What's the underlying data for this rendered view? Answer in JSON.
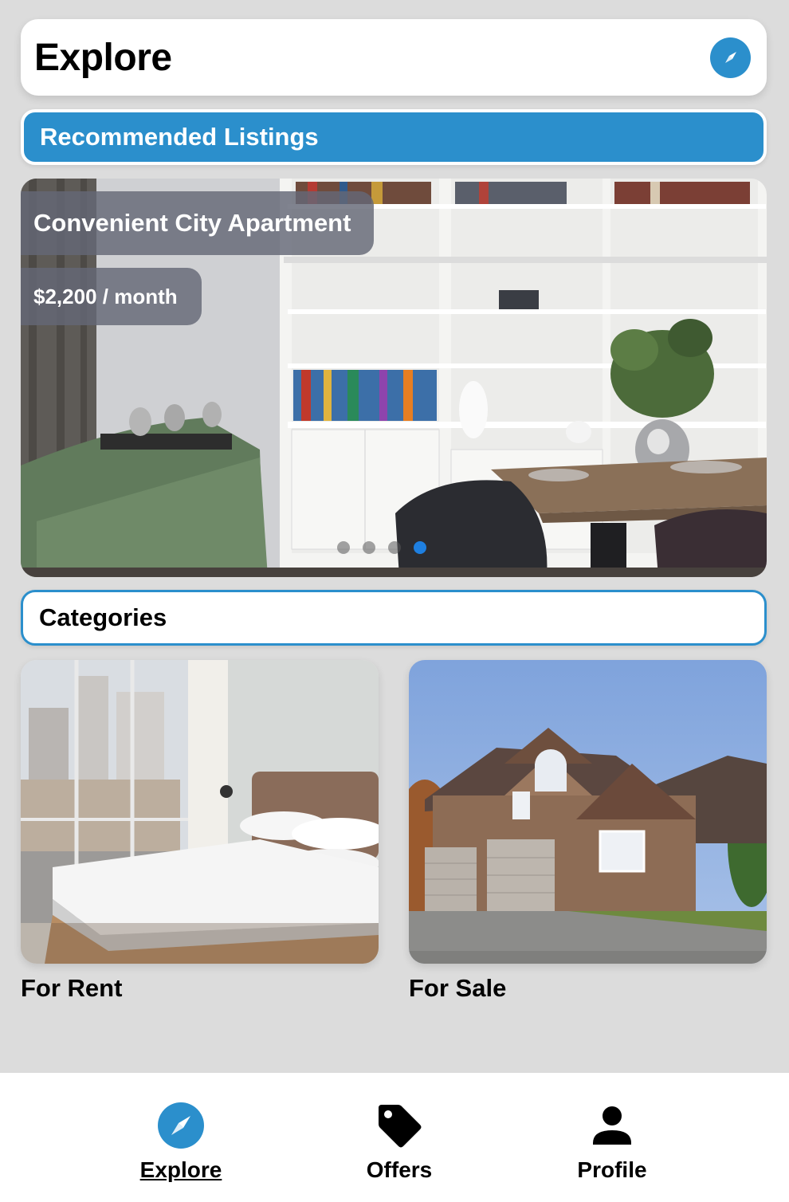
{
  "header": {
    "title": "Explore",
    "action_icon": "compass-icon"
  },
  "recommended": {
    "heading": "Recommended Listings",
    "listing": {
      "title": "Convenient City Apartment",
      "price": "$2,200 / month"
    },
    "carousel": {
      "slide_count": 4,
      "active_index": 3
    }
  },
  "categories": {
    "heading": "Categories",
    "items": [
      {
        "label": "For Rent",
        "image": "bedroom-photo"
      },
      {
        "label": "For Sale",
        "image": "house-photo"
      }
    ]
  },
  "bottom_nav": {
    "items": [
      {
        "label": "Explore",
        "icon": "compass-icon",
        "active": true
      },
      {
        "label": "Offers",
        "icon": "tag-icon",
        "active": false
      },
      {
        "label": "Profile",
        "icon": "person-icon",
        "active": false
      }
    ]
  },
  "colors": {
    "accent": "#2b8fcc",
    "background": "#dcdcdc",
    "active_dot": "#1e7fe0"
  }
}
